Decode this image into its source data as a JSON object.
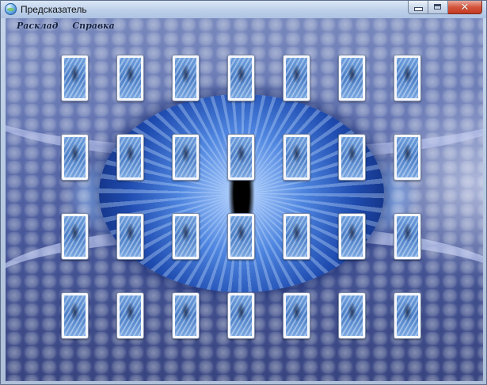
{
  "window": {
    "title": "Предсказатель"
  },
  "caption_buttons": {
    "minimize_icon": "minimize-icon",
    "maximize_icon": "maximize-icon",
    "close_icon": "close-icon",
    "close_glyph": "✕"
  },
  "menu": {
    "items": [
      {
        "label": "Расклад"
      },
      {
        "label": "Справка"
      }
    ]
  },
  "cards": {
    "rows": 4,
    "columns": 7,
    "face": "card-back-blue-dragon"
  },
  "colors": {
    "accent": "#3b6cc8",
    "close_button": "#c23a22",
    "menu_text": "#16213f"
  }
}
